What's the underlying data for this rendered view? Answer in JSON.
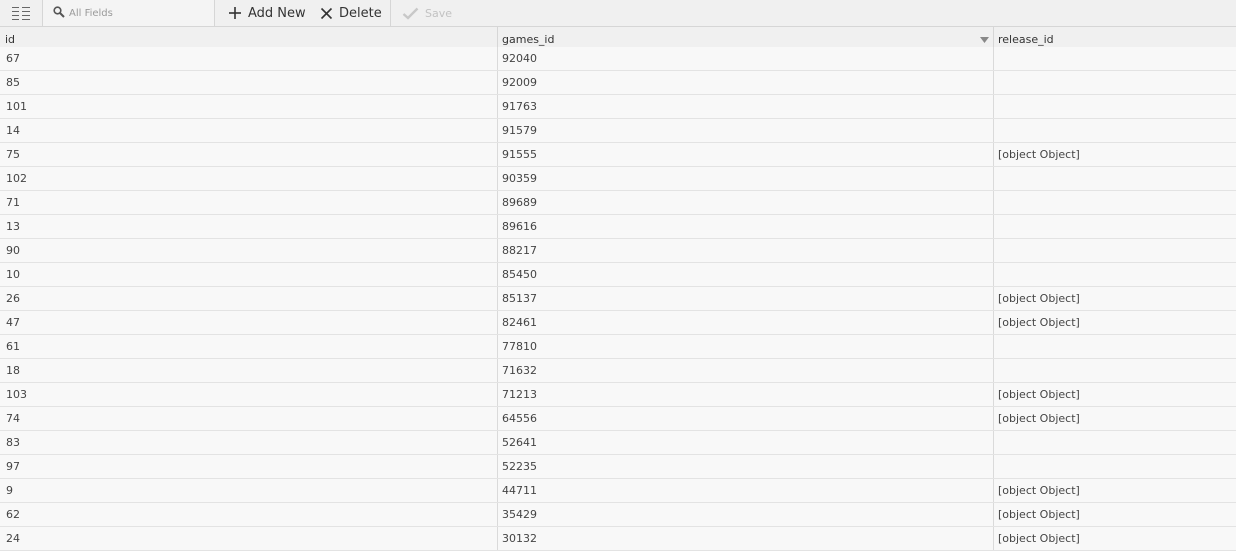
{
  "toolbar": {
    "view_icon": "list-view-icon",
    "search": {
      "placeholder": "All Fields",
      "value": "",
      "icon": "search-icon"
    },
    "add_new": {
      "label": "Add New",
      "icon": "plus-icon"
    },
    "delete": {
      "label": "Delete",
      "icon": "x-icon"
    },
    "save": {
      "label": "Save",
      "icon": "checkmark-icon",
      "enabled": false
    }
  },
  "table": {
    "columns": [
      "id",
      "games_id",
      "release_id"
    ],
    "sort": {
      "column": "games_id",
      "direction": "descending"
    },
    "rows": [
      {
        "id": "67",
        "games_id": "92040",
        "release_id": ""
      },
      {
        "id": "85",
        "games_id": "92009",
        "release_id": ""
      },
      {
        "id": "101",
        "games_id": "91763",
        "release_id": ""
      },
      {
        "id": "14",
        "games_id": "91579",
        "release_id": ""
      },
      {
        "id": "75",
        "games_id": "91555",
        "release_id": "[object Object]"
      },
      {
        "id": "102",
        "games_id": "90359",
        "release_id": ""
      },
      {
        "id": "71",
        "games_id": "89689",
        "release_id": ""
      },
      {
        "id": "13",
        "games_id": "89616",
        "release_id": ""
      },
      {
        "id": "90",
        "games_id": "88217",
        "release_id": ""
      },
      {
        "id": "10",
        "games_id": "85450",
        "release_id": ""
      },
      {
        "id": "26",
        "games_id": "85137",
        "release_id": "[object Object]"
      },
      {
        "id": "47",
        "games_id": "82461",
        "release_id": "[object Object]"
      },
      {
        "id": "61",
        "games_id": "77810",
        "release_id": ""
      },
      {
        "id": "18",
        "games_id": "71632",
        "release_id": ""
      },
      {
        "id": "103",
        "games_id": "71213",
        "release_id": "[object Object]"
      },
      {
        "id": "74",
        "games_id": "64556",
        "release_id": "[object Object]"
      },
      {
        "id": "83",
        "games_id": "52641",
        "release_id": ""
      },
      {
        "id": "97",
        "games_id": "52235",
        "release_id": ""
      },
      {
        "id": "9",
        "games_id": "44711",
        "release_id": "[object Object]"
      },
      {
        "id": "62",
        "games_id": "35429",
        "release_id": "[object Object]"
      },
      {
        "id": "24",
        "games_id": "30132",
        "release_id": "[object Object]"
      }
    ]
  }
}
